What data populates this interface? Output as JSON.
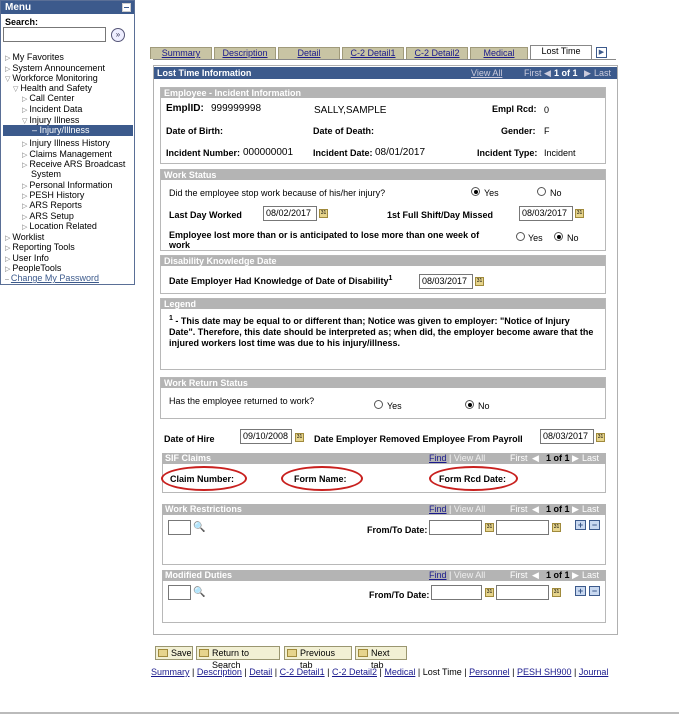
{
  "menu": {
    "title": "Menu",
    "search_label": "Search:",
    "search_go": "»",
    "items": [
      {
        "label": "My Favorites"
      },
      {
        "label": "System Announcement"
      },
      {
        "label": "Workforce Monitoring"
      },
      {
        "label": "Health and Safety"
      },
      {
        "label": "Call Center"
      },
      {
        "label": "Incident Data"
      },
      {
        "label": "Injury Illness"
      },
      {
        "label": "– Injury/Illness"
      },
      {
        "label": "Injury Illness History"
      },
      {
        "label": "Claims Management"
      },
      {
        "label": "Receive ARS Broadcast"
      },
      {
        "label": "System"
      },
      {
        "label": "Personal Information"
      },
      {
        "label": "PESH History"
      },
      {
        "label": "ARS Reports"
      },
      {
        "label": "ARS Setup"
      },
      {
        "label": "Location Related"
      },
      {
        "label": "Worklist"
      },
      {
        "label": "Reporting Tools"
      },
      {
        "label": "User Info"
      },
      {
        "label": "PeopleTools"
      },
      {
        "label": "Change My Password"
      }
    ]
  },
  "tabs": [
    "Summary",
    "Description",
    "Detail",
    "C-2 Detail1",
    "C-2 Detail2",
    "Medical",
    "Lost Time"
  ],
  "header": {
    "title": "Lost Time Information",
    "view_all": "View All",
    "first": "First",
    "count": "1 of 1",
    "last": "Last"
  },
  "employee": {
    "section_title": "Employee - Incident Information",
    "emplid_label": "EmplID:",
    "emplid_value": "999999998",
    "name": "SALLY,SAMPLE",
    "empl_rcd_label": "Empl Rcd:",
    "empl_rcd_value": "0",
    "dob_label": "Date of Birth:",
    "dod_label": "Date of Death:",
    "gender_label": "Gender:",
    "gender_value": "F",
    "incident_number_label": "Incident Number:",
    "incident_number_value": "000000001",
    "incident_date_label": "Incident Date:",
    "incident_date_value": "08/01/2017",
    "incident_type_label": "Incident Type:",
    "incident_type_value": "Incident"
  },
  "work_status": {
    "section_title": "Work Status",
    "q_stop_work": "Did the employee stop work because of his/her injury?",
    "yes": "Yes",
    "no": "No",
    "last_day_label": "Last Day Worked",
    "last_day_value": "08/02/2017",
    "first_missed_label": "1st Full Shift/Day Missed",
    "first_missed_value": "08/03/2017",
    "q_lost_week_line1": "Employee lost more than or is anticipated to lose more than one week of",
    "q_lost_week_line2": "work"
  },
  "disability": {
    "section_title": "Disability Knowledge Date",
    "label": "Date Employer Had Knowledge of Date of Disability",
    "sup": "1",
    "value": "08/03/2017"
  },
  "legend": {
    "section_title": "Legend",
    "sup": "1",
    "text": " - This date may be equal to or different than; Notice was given to employer: \"Notice of Injury Date\". Therefore, this date should be interpreted as; when did, the employer become aware that the injured workers lost time was due to his injury/illness."
  },
  "work_return": {
    "section_title": "Work Return Status",
    "question": "Has the employee returned to work?",
    "yes": "Yes",
    "no": "No"
  },
  "hire": {
    "hire_label": "Date of Hire",
    "hire_value": "09/10/2008",
    "removed_label": "Date Employer Removed Employee From Payroll",
    "removed_value": "08/03/2017"
  },
  "sif_claims": {
    "title": "SIF Claims",
    "find": "Find",
    "view_all": "View All",
    "first": "First",
    "count": "1 of 1",
    "last": "Last",
    "claim_number_label": "Claim Number:",
    "form_name_label": "Form Name:",
    "form_rcd_date_label": "Form Rcd Date:"
  },
  "work_restrictions": {
    "title": "Work Restrictions",
    "find": "Find",
    "view_all": "View All",
    "first": "First",
    "count": "1 of 1",
    "last": "Last",
    "from_to_label": "From/To Date:"
  },
  "modified_duties": {
    "title": "Modified Duties",
    "find": "Find",
    "view_all": "View All",
    "first": "First",
    "count": "1 of 1",
    "last": "Last",
    "from_to_label": "From/To Date:"
  },
  "buttons": {
    "save": "Save",
    "return": "Return to Search",
    "previous": "Previous tab",
    "next": "Next tab"
  },
  "bottom_links": [
    "Summary",
    "Description",
    "Detail",
    "C-2 Detail1",
    "C-2 Detail2",
    "Medical",
    "Lost Time",
    "Personnel",
    "PESH SH900",
    "Journal"
  ]
}
